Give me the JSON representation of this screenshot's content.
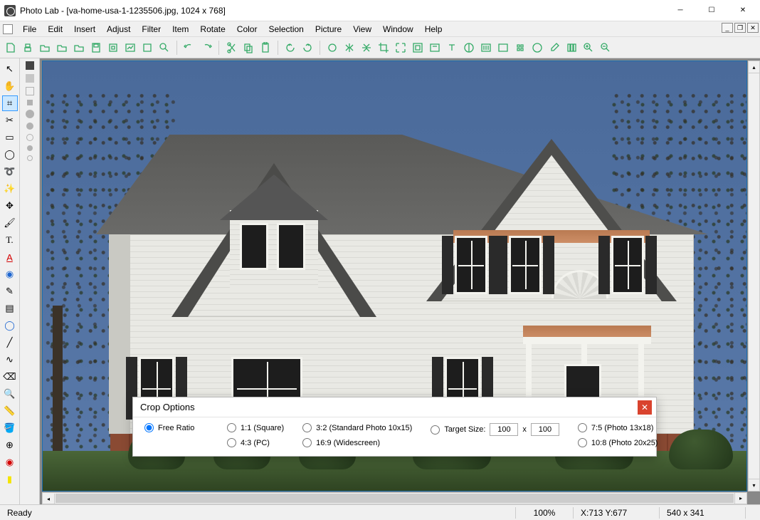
{
  "title": "Photo Lab - [va-home-usa-1-1235506.jpg, 1024 x 768]",
  "menu": [
    "File",
    "Edit",
    "Insert",
    "Adjust",
    "Filter",
    "Item",
    "Rotate",
    "Color",
    "Selection",
    "Picture",
    "View",
    "Window",
    "Help"
  ],
  "toolbar": [
    "new",
    "print",
    "open",
    "open-folder",
    "recent",
    "save",
    "export",
    "import-image",
    "print-preview",
    "browse",
    "separator",
    "undo",
    "redo",
    "separator",
    "cut",
    "copy",
    "paste",
    "separator",
    "rotate-ccw",
    "rotate-cw",
    "separator",
    "free-rotate",
    "flip-h",
    "flip-v",
    "crop",
    "fit",
    "center",
    "text-box",
    "text",
    "contrast",
    "levels",
    "grayscale",
    "palette",
    "color-balance",
    "eyedropper",
    "channels",
    "zoom-in",
    "zoom-out"
  ],
  "left_tools": [
    {
      "name": "pointer",
      "glyph": "↖",
      "active": false
    },
    {
      "name": "hand",
      "glyph": "✋",
      "active": false
    },
    {
      "name": "crop",
      "glyph": "⌗",
      "active": true
    },
    {
      "name": "scissors",
      "glyph": "✂",
      "active": false
    },
    {
      "name": "rect-select",
      "glyph": "▭",
      "active": false
    },
    {
      "name": "ellipse-select",
      "glyph": "◯",
      "active": false
    },
    {
      "name": "lasso",
      "glyph": "➰",
      "active": false
    },
    {
      "name": "wand",
      "glyph": "✨",
      "active": false
    },
    {
      "name": "move",
      "glyph": "✥",
      "active": false
    },
    {
      "name": "paint",
      "glyph": "🖌",
      "active": false
    },
    {
      "name": "text",
      "glyph": "T.",
      "active": false
    },
    {
      "name": "red-text",
      "glyph": "A",
      "active": false,
      "color": "#d40000",
      "underline": true
    },
    {
      "name": "stamp",
      "glyph": "◉",
      "active": false,
      "color": "#1e66d0"
    },
    {
      "name": "pencil",
      "glyph": "✎",
      "active": false
    },
    {
      "name": "gradient",
      "glyph": "▤",
      "active": false
    },
    {
      "name": "shape-ellipse",
      "glyph": "◯",
      "active": false,
      "color": "#1e66d0"
    },
    {
      "name": "line",
      "glyph": "╱",
      "active": false
    },
    {
      "name": "curve",
      "glyph": "∿",
      "active": false
    },
    {
      "name": "eraser",
      "glyph": "⌫",
      "active": false
    },
    {
      "name": "zoom",
      "glyph": "🔍",
      "active": false,
      "color": "#1e66d0"
    },
    {
      "name": "ruler",
      "glyph": "📏",
      "active": false
    },
    {
      "name": "bucket",
      "glyph": "🪣",
      "active": false
    },
    {
      "name": "clone",
      "glyph": "⊕",
      "active": false
    },
    {
      "name": "redeye",
      "glyph": "◉",
      "active": false,
      "color": "#d40000"
    },
    {
      "name": "highlight",
      "glyph": "▮",
      "active": false,
      "color": "#f4e400"
    }
  ],
  "crop": {
    "title": "Crop Options",
    "free": "Free Ratio",
    "r11": "1:1 (Square)",
    "r43": "4:3 (PC)",
    "r32": "3:2 (Standard Photo 10x15)",
    "r169": "16:9 (Widescreen)",
    "target": "Target Size:",
    "tw": "100",
    "th": "100",
    "x": "x",
    "r75": "7:5 (Photo 13x18)",
    "r108": "10:8 (Photo 20x25)"
  },
  "status": {
    "ready": "Ready",
    "zoom": "100%",
    "coords": "X:713  Y:677",
    "size": "540 x 341"
  }
}
